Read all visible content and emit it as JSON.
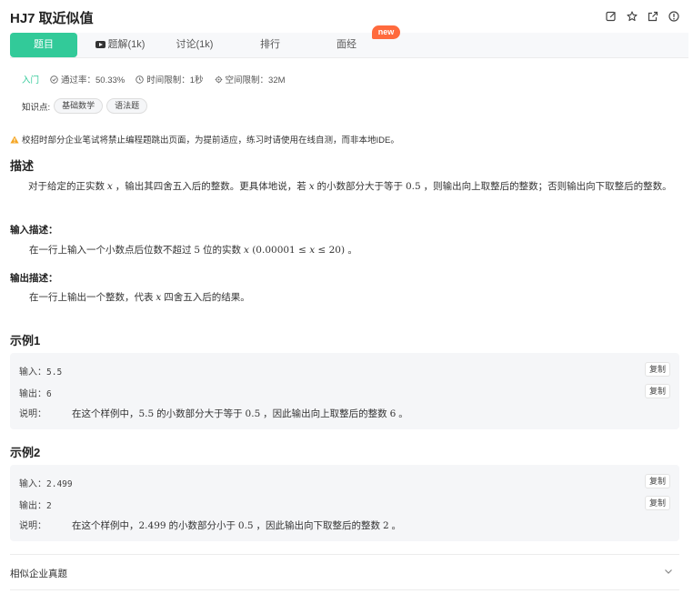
{
  "header": {
    "title": "HJ7  取近似值",
    "icons": [
      "edit-icon",
      "star-icon",
      "share-icon",
      "info-icon"
    ]
  },
  "tabs": [
    {
      "label": "题目",
      "active": true
    },
    {
      "label": "题解(1k)",
      "active": false,
      "icon": "video-icon"
    },
    {
      "label": "讨论(1k)",
      "active": false
    },
    {
      "label": "排行",
      "active": false
    },
    {
      "label": "面经",
      "active": false
    }
  ],
  "new_badge": "new",
  "meta": {
    "level": "入门",
    "pass_rate": "通过率：50.33%",
    "time_limit": "时间限制：1秒",
    "space_limit": "空间限制：32M"
  },
  "knowledge": {
    "label": "知识点:",
    "tags": [
      "基础数学",
      "语法题"
    ]
  },
  "notice": "校招时部分企业笔试将禁止编程题跳出页面，为提前适应，练习时请使用在线自测，而非本地IDE。",
  "description": {
    "heading": "描述",
    "parts": [
      "对于给定的正实数 ",
      "x",
      " ，输出其四舍五入后的整数。更具体地说，若 ",
      "x",
      " 的小数部分大于等于 ",
      "0.5",
      " ，则输出向上取整后的整数；否则输出向下取整后的整数。"
    ]
  },
  "input_desc": {
    "heading": "输入描述：",
    "parts": [
      "在一行上输入一个小数点后位数不超过 ",
      "5",
      " 位的实数 ",
      "x",
      " (0.00001 ≤ ",
      "x",
      " ≤ 20) 。"
    ]
  },
  "output_desc": {
    "heading": "输出描述：",
    "parts": [
      "在一行上输出一个整数，代表 ",
      "x",
      " 四舍五入后的结果。"
    ]
  },
  "examples": [
    {
      "heading": "示例1",
      "input_label": "输入：",
      "input": "5.5",
      "output_label": "输出：",
      "output": "6",
      "explain_label": "说明：",
      "explain_parts": [
        "在这个样例中，",
        "5.5",
        " 的小数部分大于等于 ",
        "0.5",
        " ，因此输出向上取整后的整数 ",
        "6",
        " 。"
      ],
      "copy_label": "复制"
    },
    {
      "heading": "示例2",
      "input_label": "输入：",
      "input": "2.499",
      "output_label": "输出：",
      "output": "2",
      "explain_label": "说明：",
      "explain_parts": [
        "在这个样例中，",
        "2.499",
        " 的小数部分小于 ",
        "0.5",
        " ，因此输出向下取整后的整数 ",
        "2",
        " 。"
      ],
      "copy_label": "复制"
    }
  ],
  "similar": {
    "label": "相似企业真题"
  },
  "colors": {
    "accent": "#32ca99",
    "badge": "#ff6a3d",
    "warning": "#f5a623"
  }
}
